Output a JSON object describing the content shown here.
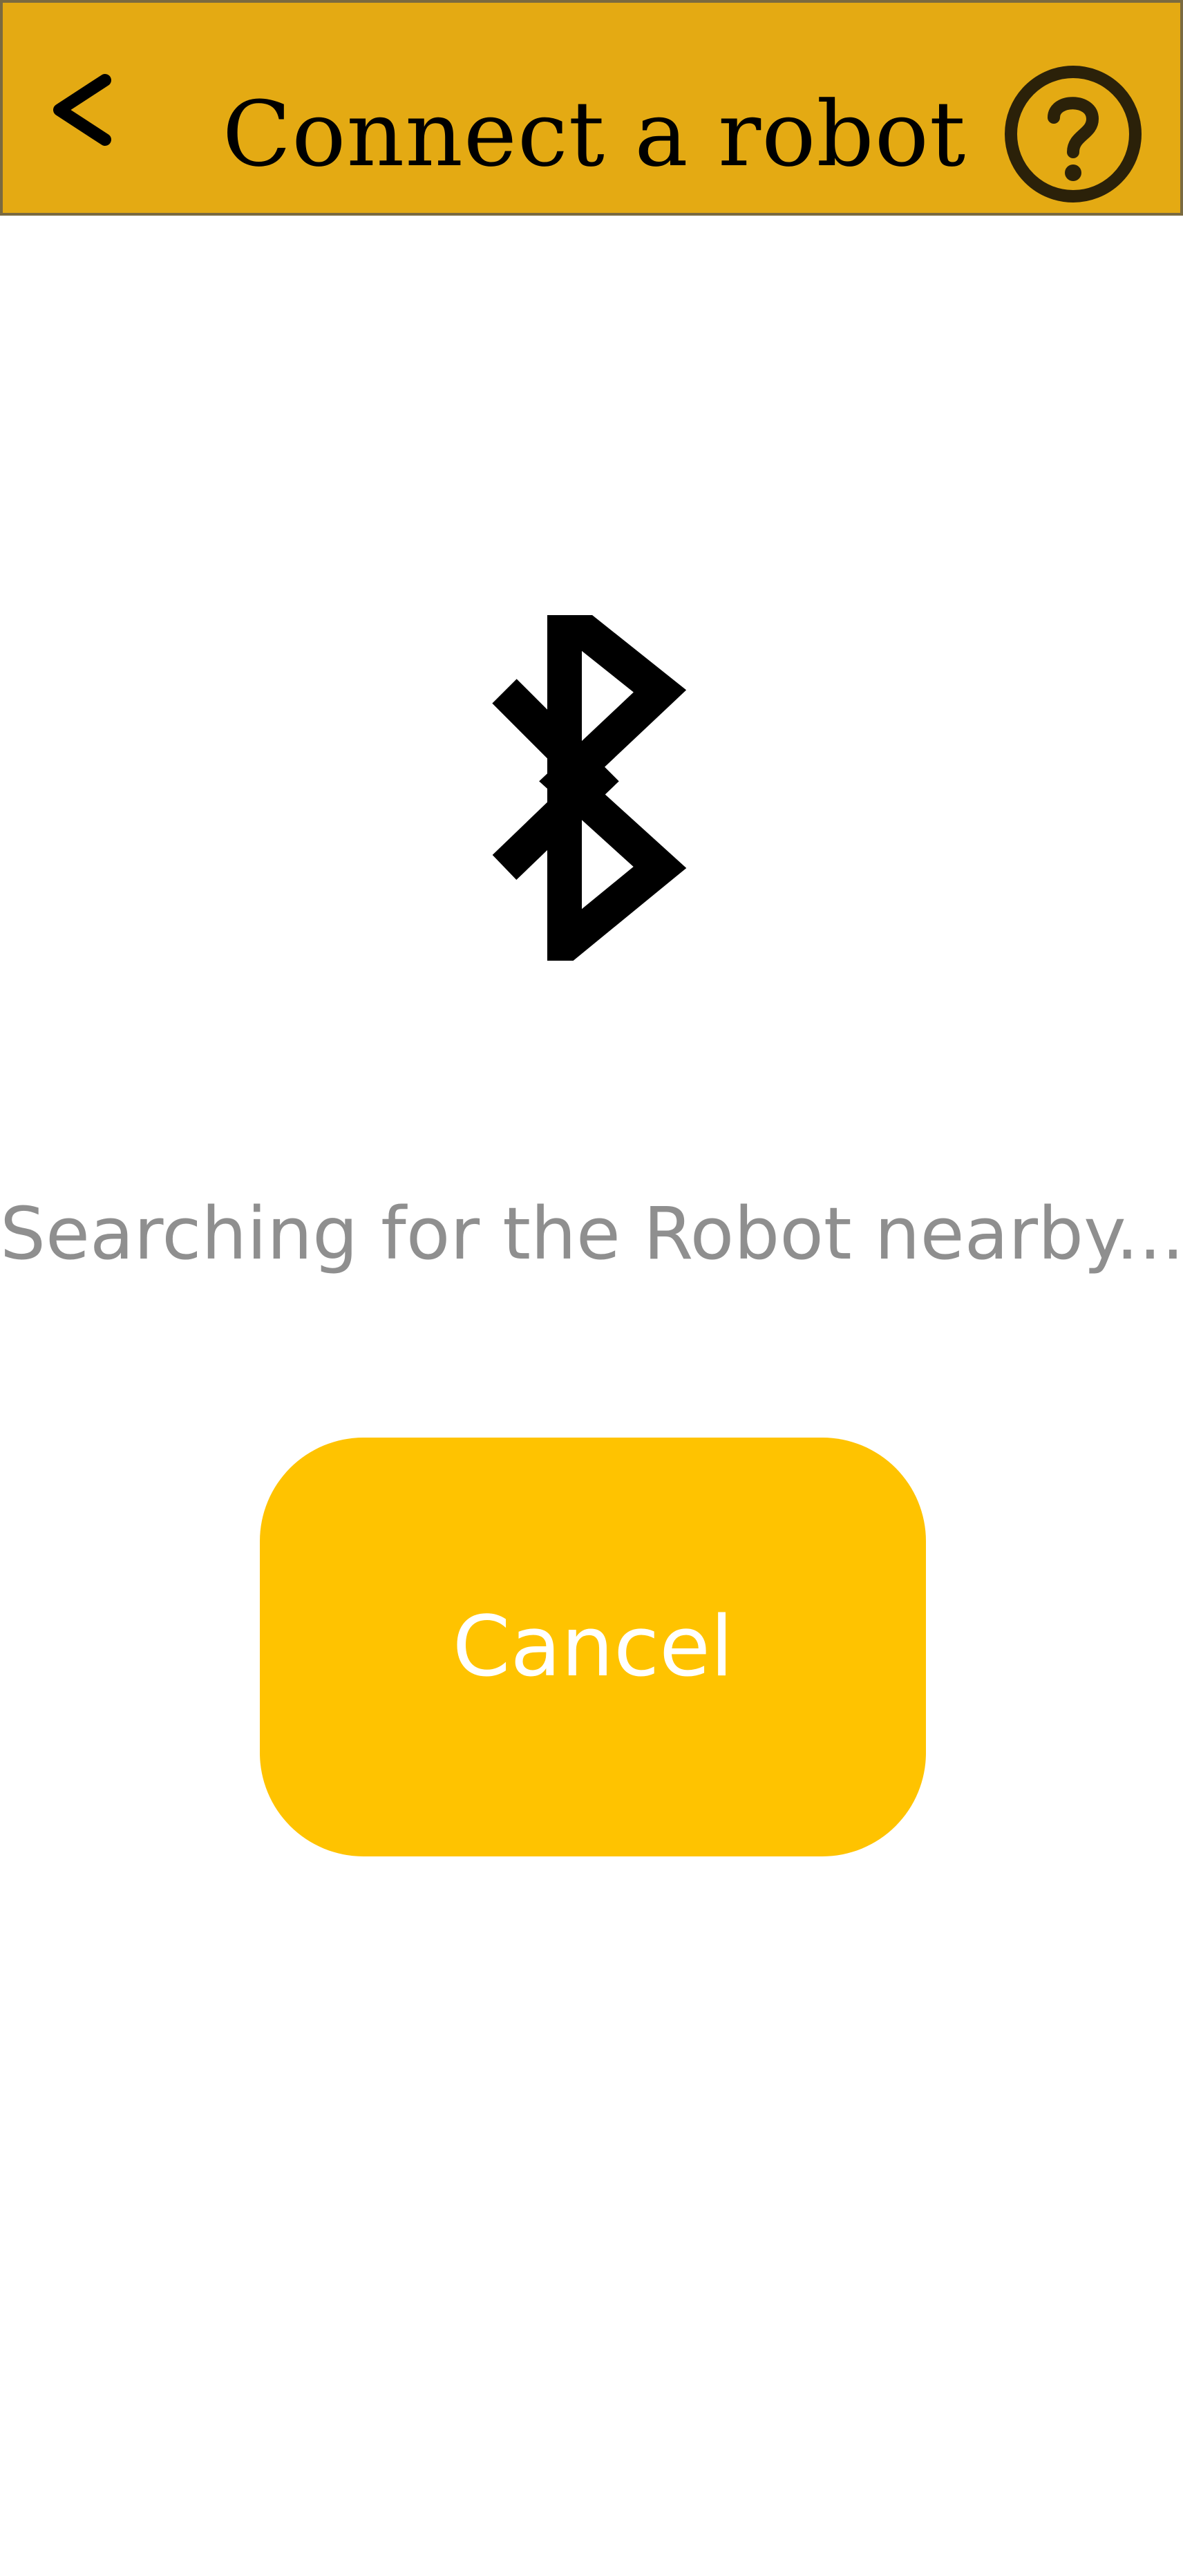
{
  "header": {
    "title": "Connect a robot",
    "back_icon": "chevron-left-icon",
    "help_icon": "help-circle-icon",
    "background_color": "#E4AA13"
  },
  "main": {
    "status_icon": "bluetooth-icon",
    "status_text": "Searching for the Robot nearby...",
    "cancel_label": "Cancel",
    "cancel_color": "#FFC300"
  }
}
